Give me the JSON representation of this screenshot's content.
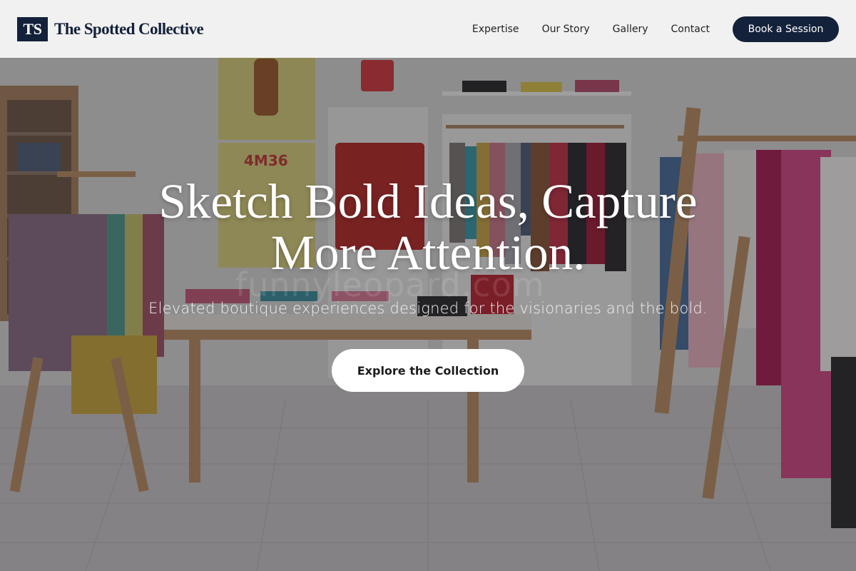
{
  "brand": {
    "mark": "TS",
    "name": "The Spotted Collective"
  },
  "nav": {
    "links": [
      {
        "label": "Expertise"
      },
      {
        "label": "Our Story"
      },
      {
        "label": "Gallery"
      },
      {
        "label": "Contact"
      }
    ],
    "cta_label": "Book a Session"
  },
  "hero": {
    "title_line1": "Sketch Bold Ideas, Capture",
    "title_line2": "More Attention.",
    "subtitle": "Elevated boutique experiences designed for the visionaries and the bold.",
    "cta_label": "Explore the Collection",
    "poster_text": "4M36",
    "watermark": "funnyleopard.com"
  },
  "colors": {
    "primary": "#14213a",
    "header_bg": "#f8f8f8",
    "cta_bg": "#ffffff"
  }
}
